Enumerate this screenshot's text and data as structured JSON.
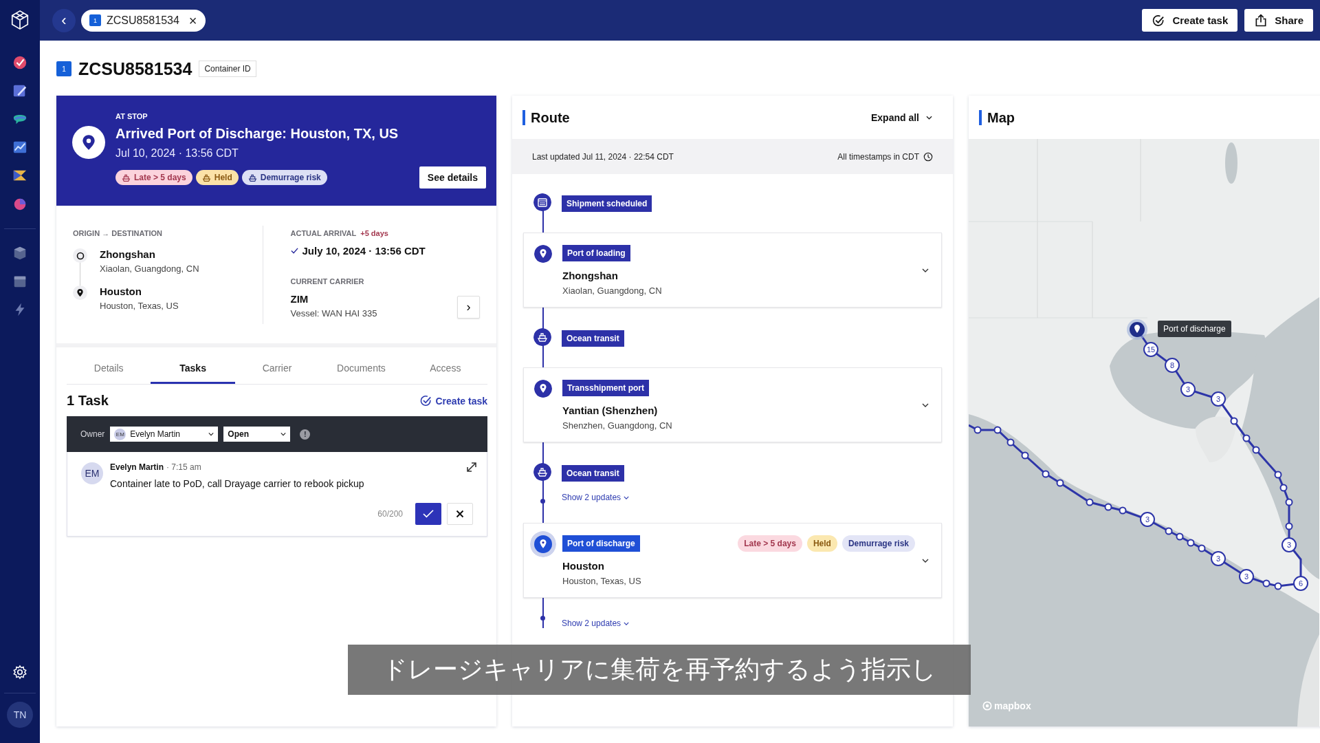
{
  "top_bar": {
    "back": "‹",
    "tab": {
      "badge": "1",
      "label": "ZCSU8581534",
      "close": "×"
    },
    "buttons": [
      {
        "kind": "task",
        "label": "Create task"
      },
      {
        "kind": "share",
        "label": "Share"
      }
    ]
  },
  "sidebar": {
    "avatar": "TN"
  },
  "header": {
    "badge": "1",
    "title": "ZCSU8581534",
    "tag": "Container ID"
  },
  "status": {
    "eyebrow": "AT STOP",
    "title": "Arrived Port of Discharge: Houston, TX, US",
    "time": "Jul 10, 2024 · 13:56 CDT",
    "button": "See details",
    "tags": [
      {
        "kind": "late",
        "label": "Late > 5 days",
        "color": "#fbd3dc"
      },
      {
        "kind": "held",
        "label": "Held",
        "color": "#fbe2a8"
      },
      {
        "kind": "risk",
        "label": "Demurrage risk",
        "color": "#dde0f5"
      }
    ]
  },
  "summary": {
    "od_label": "ORIGIN → DESTINATION",
    "origin": {
      "name": "Zhongshan",
      "place": "Xiaolan, Guangdong, CN"
    },
    "destination": {
      "name": "Houston",
      "place": "Houston, Texas, US"
    },
    "arrival": {
      "label": "ACTUAL ARRIVAL",
      "delta": "+5 days",
      "value": "July 10, 2024 · 13:56 CDT"
    },
    "carrier": {
      "label": "CURRENT CARRIER",
      "name": "ZIM",
      "vessel": "Vessel: WAN HAI 335",
      "more": "›"
    }
  },
  "tabs": [
    {
      "label": "Details",
      "selected": false
    },
    {
      "label": "Tasks",
      "selected": true
    },
    {
      "label": "Carrier",
      "selected": false
    },
    {
      "label": "Documents",
      "selected": false
    },
    {
      "label": "Access",
      "selected": false
    }
  ],
  "tasks": {
    "title": "1 Task",
    "create": "Create task",
    "owner_label": "Owner",
    "owner": {
      "initials": "EM",
      "name": "Evelyn Martin"
    },
    "status": "Open",
    "alert": "!",
    "comment": {
      "initials": "EM",
      "author": "Evelyn Martin",
      "time": "· 7:15 am",
      "text": "Container late to PoD, call Drayage carrier to rebook pickup",
      "count": "60/200"
    }
  },
  "route": {
    "title": "Route",
    "expand": "Expand all",
    "updated": "Last updated Jul 11, 2024 · 22:54 CDT",
    "tz": "All timestamps in CDT",
    "stops": [
      {
        "kind": "scheduled",
        "label": "Shipment scheduled"
      },
      {
        "kind": "port",
        "label": "Port of loading",
        "name": "Zhongshan",
        "place": "Xiaolan, Guangdong, CN",
        "current": false
      },
      {
        "kind": "transit",
        "label": "Ocean transit"
      },
      {
        "kind": "port",
        "label": "Transshipment port",
        "name": "Yantian (Shenzhen)",
        "place": "Shenzhen, Guangdong, CN",
        "current": false
      },
      {
        "kind": "transit",
        "label": "Ocean transit",
        "updates": "Show 2 updates"
      },
      {
        "kind": "port",
        "label": "Port of discharge",
        "name": "Houston",
        "place": "Houston, Texas, US",
        "current": true,
        "tags": [
          {
            "kind": "late",
            "label": "Late > 5 days",
            "color": "#fbd9e0"
          },
          {
            "kind": "held",
            "label": "Held",
            "color": "#fbe8b0"
          },
          {
            "kind": "risk",
            "label": "Demurrage risk",
            "color": "#e3e5f6"
          }
        ]
      },
      {
        "kind": "updates",
        "updates": "Show 2 updates"
      }
    ]
  },
  "map": {
    "title": "Map",
    "tooltip": "Port of discharge",
    "clusters": [
      "15",
      "8",
      "3",
      "3",
      "3",
      "6",
      "3",
      "3",
      "3"
    ],
    "attribution": "mapbox"
  },
  "caption": "ドレージキャリアに集荷を再予約するよう指示し"
}
